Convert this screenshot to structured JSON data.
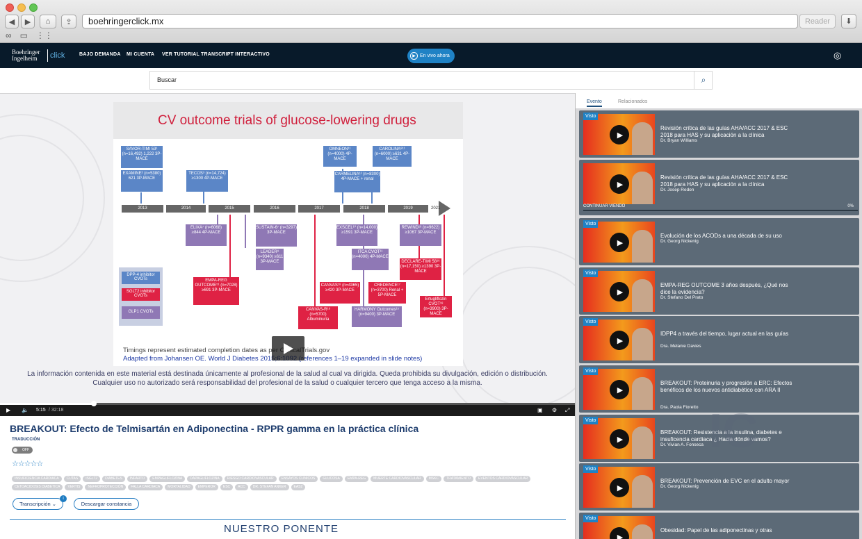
{
  "browser": {
    "url": "boehringerclick.mx",
    "reader_label": "Reader"
  },
  "nav": {
    "logo_line1": "Boehringer",
    "logo_line2": "Ingelheim",
    "logo_click": "click",
    "links": [
      "BAJO DEMANDA",
      "MI CUENTA",
      "VER TUTORIAL TRANSCRIPT INTERACTIVO"
    ],
    "live_label": "En vivo ahora"
  },
  "search": {
    "placeholder": "Buscar"
  },
  "slide": {
    "title": "CV outcome trials of glucose-lowering drugs",
    "years": [
      "2013",
      "2014",
      "2015",
      "2016",
      "2017",
      "2018",
      "2019",
      "2021"
    ],
    "boxes": {
      "savor": "SAVOR-TIMI 53¹ (n=16,492) 1,222 3P-MACE",
      "examine": "EXAMINE² (n=5380) 621 3P-MACE",
      "tecos": "TECOS³ (n=14,724) ≥1300 4P-MACE",
      "omneon": "OMNEON¹¹ (n=4000) 4P-MACE",
      "carolina": "CAROLINA⁸¹¹ (n=6000) ≥631 4P-MACE",
      "carmelina": "CARMELINA¹² (n=8300) 4P-MACE + renal",
      "elixa": "ELIXA⁷ (n=6068) ≥844 4P-MACE",
      "sustain": "SUSTAIN-6⁷ (n=3297) 3P-MACE",
      "leader": "LEADER⁸ (n=9340) ≥611 3P-MACE",
      "empa": "EMPA-REG OUTCOME⁵¹ (n=7028) ≥691 3P-MACE",
      "exscel": "EXSCEL¹⁰ (n=14,000) ≥1591 3P-MACE",
      "itca": "ITCA CVOT¹¹ (n=4000) 4P-MACE",
      "rewind": "REWIND¹⁶ (n=9622) ≥1067 3P-MACE",
      "declare": "DECLARE-TIMI 58¹⁶ (n=17,150) ≥1390 3P-MACE",
      "canvas": "CANVAS¹⁸ (n=4365) ≥420 3P-MACE",
      "credence": "CREDENCE¹⁷ (n=3700) Renal + 5P-MACE",
      "canvasr": "CANVAS-R¹⁸ (n=5700) Albuminuria",
      "harmony": "HARMONY Outcomes¹⁵ (n=9400) 3P-MACE",
      "ertu": "Ertugliflozin CVOT¹⁸ (n=3900) 3P-MACE"
    },
    "legend": [
      "DPP-4 inhibitor CVOTs",
      "SGLT2 inhibitor CVOTs",
      "GLP1 CVOTs"
    ],
    "footnote1": "Timings represent estimated completion dates as per ClinicalTrials.gov",
    "footnote2": "Adapted from Johansen OE. World J Diabetes 2015;6:1092 (references 1–19 expanded in slide notes)",
    "disclaimer": "La información contenida en este material está destinada únicamente al profesional de la salud al cual va dirigida. Queda prohibida su divulgación, edición o distribución. Cualquier uso no autorizado será responsabilidad del profesional de la salud o cualquier tercero que tenga acceso a la misma."
  },
  "player": {
    "current_time": "5:15",
    "duration": "/ 32:18",
    "progress": 0.163
  },
  "video": {
    "title": "BREAKOUT: Efecto de Telmisartán en Adiponectina - RPPR gamma en la práctica clínica",
    "translation_label": "TRADUCCIÓN",
    "toggle_label": "OFF",
    "stars": "☆☆☆☆☆",
    "tags": [
      "INSUFICIENCIA CARDIACA",
      "CUTAS",
      "ISGLT2",
      "DIABETES",
      "INFARTO",
      "EMPAGLIFLOZINA",
      "DAPAGLIFLOZINA",
      "RIESGO CARDIOVASCULAR",
      "ENSAYOS CLINICOS",
      "GLUCOSA",
      "EMPA-REG",
      "MUERTE CARDIOVASCULAR",
      "MSKC",
      "TRATAMIENTO",
      "EVENTOS CARDIOVASCULAR",
      "CETOACIDOSIS DIABETICA",
      "VERTIS",
      "NEFROPROTECCIÓN",
      "FALLA CARDIACA",
      "MORTALIDAD",
      "EMPEROR",
      "ESC",
      "ACC",
      "DR. STEFAN ANKER",
      "EAS2"
    ],
    "transcript_label": "Transcripción",
    "transcript_badge": "i",
    "download_label": "Descargar constancia",
    "speaker_heading": "NUESTRO PONENTE"
  },
  "sidebar": {
    "tabs": [
      "Evento",
      "Relacionados"
    ],
    "watermark": "IC",
    "continue_label": "CONTINUAR VIENDO",
    "continue_pct": "0%",
    "visto_label": "Visto",
    "cards": [
      {
        "title": "Revisión crítica de las guías AHA/ACC 2017 & ESC 2018 para HAS y su aplicación a la clínica",
        "author": "Dr. Bryan Williams"
      },
      {
        "title": "Revisión crítica de las guías AHA/ACC 2017 & ESC 2018 para HAS y su aplicación a la clínica",
        "author": "Dr. Josep Redon"
      },
      {
        "title": "Evolución de los ACODs a una década de su uso",
        "author": "Dr. Georg Nickenig"
      },
      {
        "title": "EMPA-REG OUTCOME 3 años después, ¿Qué nos dice la evidencia?",
        "author": "Dr. Stefano Del Prato"
      },
      {
        "title": "IDPP4 a través del tiempo, lugar actual en las guías",
        "author": "Dra. Melanie Davies"
      },
      {
        "title": "BREAKOUT: Proteinuria y progresión a ERC: Efectos benéficos de los nuevos antidiabético con ARA II",
        "author": "Dra. Paola Fioretto"
      },
      {
        "title": "BREAKOUT: Resistencia a la insulina, diabetes e insuficencia cardiaca ¿ Hacia dónde vamos?",
        "author": "Dr. Vivian A. Fonseca"
      },
      {
        "title": "BREAKOUT: Prevención de EVC en el adulto mayor",
        "author": "Dr. Georg Nickenig"
      },
      {
        "title": "Obesidad: Papel de las adiponectinas y otras",
        "author": ""
      }
    ]
  }
}
